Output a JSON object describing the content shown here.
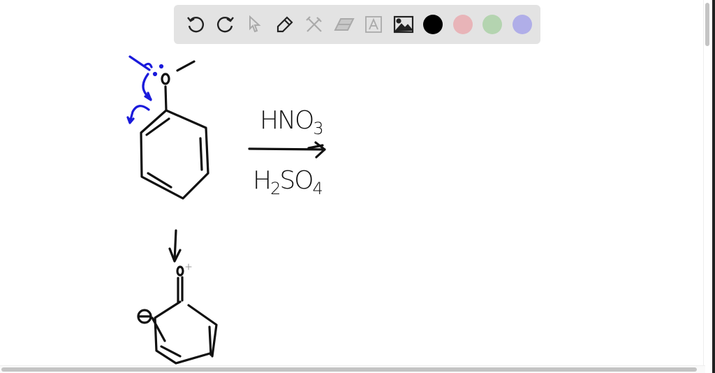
{
  "toolbar": {
    "tools": [
      {
        "name": "undo-icon",
        "enabled": true
      },
      {
        "name": "redo-icon",
        "enabled": true
      },
      {
        "name": "select-icon",
        "enabled": false
      },
      {
        "name": "pen-icon",
        "enabled": true
      },
      {
        "name": "tools-icon",
        "enabled": false
      },
      {
        "name": "eraser-icon",
        "enabled": false
      },
      {
        "name": "text-icon",
        "enabled": false
      },
      {
        "name": "image-icon",
        "enabled": true
      }
    ],
    "colors": [
      "#000000",
      "#e8b4b8",
      "#b4d4b0",
      "#b0aee8"
    ],
    "selected_color": "#000000"
  },
  "drawing": {
    "reagent_top": {
      "main": "HNO",
      "sub": "3"
    },
    "reagent_bottom": {
      "a": "H",
      "a_sub": "2",
      "b": "SO",
      "b_sub": "4"
    },
    "ink_color": "#111111",
    "annotation_color": "#1a1adb"
  }
}
